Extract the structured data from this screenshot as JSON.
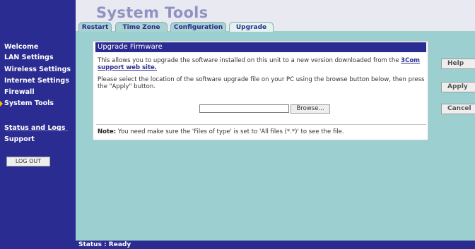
{
  "header": {
    "title": "System Tools"
  },
  "tabs": [
    {
      "label": "Restart"
    },
    {
      "label": "Time Zone"
    },
    {
      "label": "Configuration"
    },
    {
      "label": "Upgrade",
      "active": true
    }
  ],
  "sidebar": {
    "items": [
      {
        "label": "Welcome"
      },
      {
        "label": "LAN Settings"
      },
      {
        "label": "Wireless Settings"
      },
      {
        "label": "Internet Settings"
      },
      {
        "label": "Firewall"
      },
      {
        "label": "System Tools",
        "active": true
      },
      {
        "label": "Status and Logs"
      },
      {
        "label": "Support"
      }
    ],
    "logout_label": "LOG OUT"
  },
  "panel": {
    "title": "Upgrade Firmware",
    "description": "This allows you to upgrade the software installed on this unit to a new version downloaded from the ",
    "link_text": "3Com support web site.",
    "instructions": "Please select the location of the software upgrade file on your PC using the browse button below, then press the \"Apply\" button.",
    "file_value": "",
    "browse_label": "Browse...",
    "note_label": "Note:",
    "note_text": " You need make sure the 'Files of type' is set to 'All files (*.*)' to see the file."
  },
  "actions": {
    "help_label": "Help",
    "apply_label": "Apply",
    "cancel_label": "Cancel"
  },
  "status": {
    "text": "Status : Ready"
  },
  "colors": {
    "nav_bg": "#2b2c91",
    "content_bg": "#9ccfd0",
    "header_bg": "#e9e9f1",
    "active_arrow": "#ffc000"
  }
}
